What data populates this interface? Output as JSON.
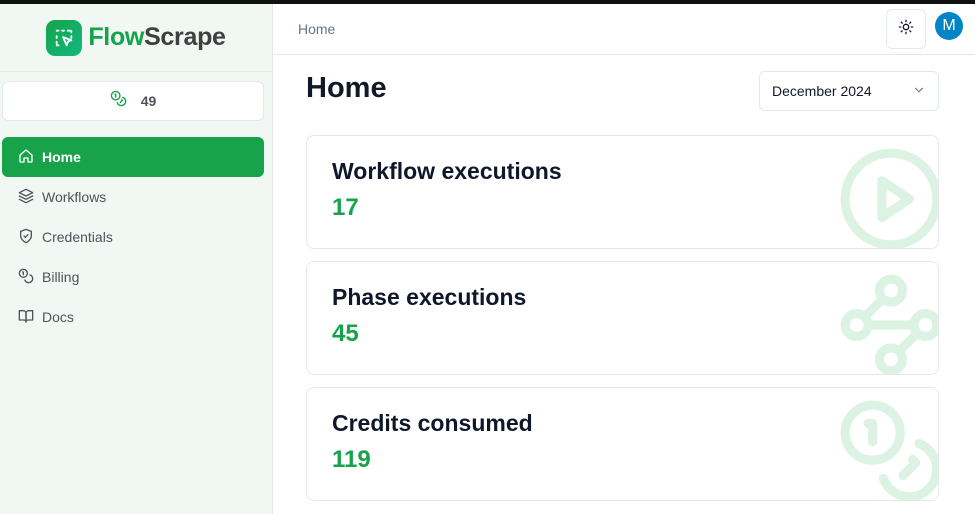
{
  "brand": {
    "name_part1": "Flow",
    "name_part2": "Scrape"
  },
  "sidebar": {
    "credits": "49",
    "items": [
      {
        "label": "Home",
        "icon": "home-icon",
        "active": true
      },
      {
        "label": "Workflows",
        "icon": "layers-icon",
        "active": false
      },
      {
        "label": "Credentials",
        "icon": "shield-check-icon",
        "active": false
      },
      {
        "label": "Billing",
        "icon": "coins-icon",
        "active": false
      },
      {
        "label": "Docs",
        "icon": "book-open-icon",
        "active": false
      }
    ]
  },
  "header": {
    "breadcrumb": "Home",
    "avatar_initial": "M"
  },
  "main": {
    "title": "Home",
    "period": "December 2024",
    "stats": [
      {
        "title": "Workflow executions",
        "value": "17",
        "icon": "circle-play-icon"
      },
      {
        "title": "Phase executions",
        "value": "45",
        "icon": "waypoints-icon"
      },
      {
        "title": "Credits consumed",
        "value": "119",
        "icon": "coins-icon"
      }
    ]
  },
  "colors": {
    "accent": "#16a34a",
    "avatar": "#0284c7",
    "sidebar_bg": "#f1f8f3"
  }
}
